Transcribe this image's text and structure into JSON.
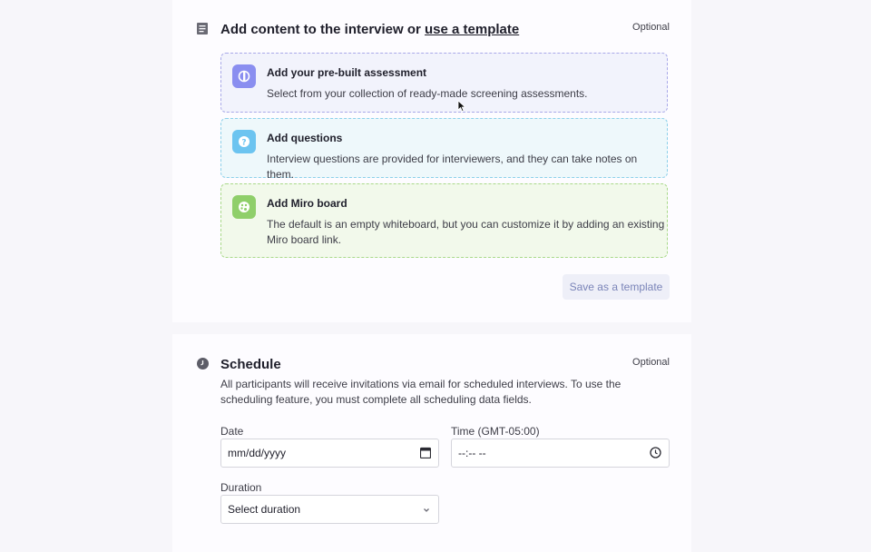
{
  "content_section": {
    "title_prefix": "Add content to the interview or ",
    "title_link": "use a template",
    "optional_label": "Optional",
    "icon": "document-icon",
    "options": [
      {
        "title": "Add your pre-built assessment",
        "description": "Select from your collection of ready-made screening assessments.",
        "icon": "assessment-icon",
        "color": "#8a8ef0"
      },
      {
        "title": "Add questions",
        "description": "Interview questions are provided for interviewers, and they can take notes on them.",
        "icon": "question-icon",
        "color": "#6cc4f0"
      },
      {
        "title": "Add Miro board",
        "description": "The default is an empty whiteboard, but you can customize it by adding an existing Miro board link.",
        "icon": "palette-icon",
        "color": "#8fcf6a"
      }
    ],
    "save_template_label": "Save as a template"
  },
  "schedule_section": {
    "title": "Schedule",
    "optional_label": "Optional",
    "icon": "clock-icon",
    "description": "All participants will receive invitations via email for scheduled interviews. To use the scheduling feature, you must complete all scheduling data fields.",
    "date_label": "Date",
    "date_placeholder": "mm/dd/yyyy",
    "time_label": "Time (GMT-05:00)",
    "time_placeholder": "--:-- --",
    "duration_label": "Duration",
    "duration_placeholder": "Select duration"
  }
}
